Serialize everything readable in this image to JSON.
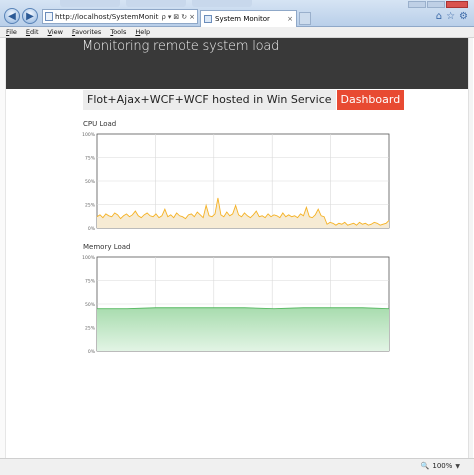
{
  "browser": {
    "url": "http://localhost/SystemMonitor.WebUI/inc",
    "address_actions": [
      "ρ",
      "▾",
      "⊠",
      "↻",
      "×"
    ],
    "tab_title": "System Monitor",
    "tab_close": "×",
    "tool_icons": [
      "home-icon",
      "star-icon",
      "gear-icon"
    ]
  },
  "menu": [
    "File",
    "Edit",
    "View",
    "Favorites",
    "Tools",
    "Help"
  ],
  "page": {
    "title": "Monitoring remote system load",
    "banner_text": "Flot+Ajax+WCF+WCF hosted in Win Service",
    "banner_button": "Dashboard"
  },
  "charts": {
    "cpu_label": "CPU Load",
    "memory_label": "Memory Load"
  },
  "colors": {
    "cpu_line": "#f5b225",
    "cpu_fill": "#f6ebd4",
    "memory_line": "#56b861",
    "memory_fill_top": "#a8dcae",
    "memory_fill_bottom": "#e2f4e5",
    "banner_accent": "#e84a32",
    "header_bg": "#393939"
  },
  "status": {
    "zoom": "100%"
  },
  "chart_data": [
    {
      "type": "area",
      "title": "CPU Load",
      "y_ticks": [
        "0%",
        "25%",
        "50%",
        "75%",
        "100%"
      ],
      "ylim": [
        0,
        100
      ],
      "grid": true,
      "x": [
        0,
        1,
        2,
        3,
        4,
        5,
        6,
        7,
        8,
        9,
        10,
        11,
        12,
        13,
        14,
        15,
        16,
        17,
        18,
        19,
        20,
        21,
        22,
        23,
        24,
        25,
        26,
        27,
        28,
        29,
        30,
        31,
        32,
        33,
        34,
        35,
        36,
        37,
        38,
        39,
        40,
        41,
        42,
        43,
        44,
        45,
        46,
        47,
        48,
        49,
        50,
        51,
        52,
        53,
        54,
        55,
        56,
        57,
        58,
        59,
        60,
        61,
        62,
        63,
        64,
        65,
        66,
        67,
        68,
        69,
        70,
        71,
        72,
        73,
        74,
        75,
        76,
        77,
        78,
        79,
        80,
        81,
        82,
        83,
        84,
        85,
        86,
        87,
        88,
        89,
        90,
        91,
        92,
        93,
        94,
        95,
        96,
        97,
        98,
        99
      ],
      "series": [
        {
          "values": [
            12,
            14,
            11,
            15,
            13,
            12,
            16,
            14,
            10,
            13,
            15,
            12,
            14,
            18,
            13,
            11,
            14,
            16,
            13,
            12,
            15,
            11,
            13,
            20,
            12,
            14,
            11,
            16,
            13,
            12,
            10,
            14,
            15,
            12,
            17,
            14,
            11,
            24,
            13,
            12,
            15,
            32,
            14,
            12,
            17,
            13,
            15,
            24,
            14,
            12,
            16,
            13,
            11,
            14,
            18,
            12,
            13,
            11,
            15,
            12,
            14,
            13,
            11,
            16,
            12,
            14,
            12,
            13,
            11,
            15,
            13,
            22,
            12,
            11,
            14,
            20,
            13,
            12,
            4,
            6,
            5,
            3,
            5,
            4,
            6,
            3,
            4,
            5,
            3,
            6,
            4,
            5,
            3,
            4,
            6,
            5,
            3,
            4,
            5,
            8
          ]
        }
      ]
    },
    {
      "type": "area",
      "title": "Memory Load",
      "y_ticks": [
        "0%",
        "25%",
        "50%",
        "75%",
        "100%"
      ],
      "ylim": [
        0,
        100
      ],
      "grid": true,
      "x": [
        0,
        10,
        20,
        30,
        40,
        50,
        60,
        70,
        80,
        90,
        99
      ],
      "series": [
        {
          "values": [
            45,
            45,
            46,
            46,
            46,
            46,
            45,
            46,
            46,
            46,
            45
          ]
        }
      ]
    }
  ]
}
